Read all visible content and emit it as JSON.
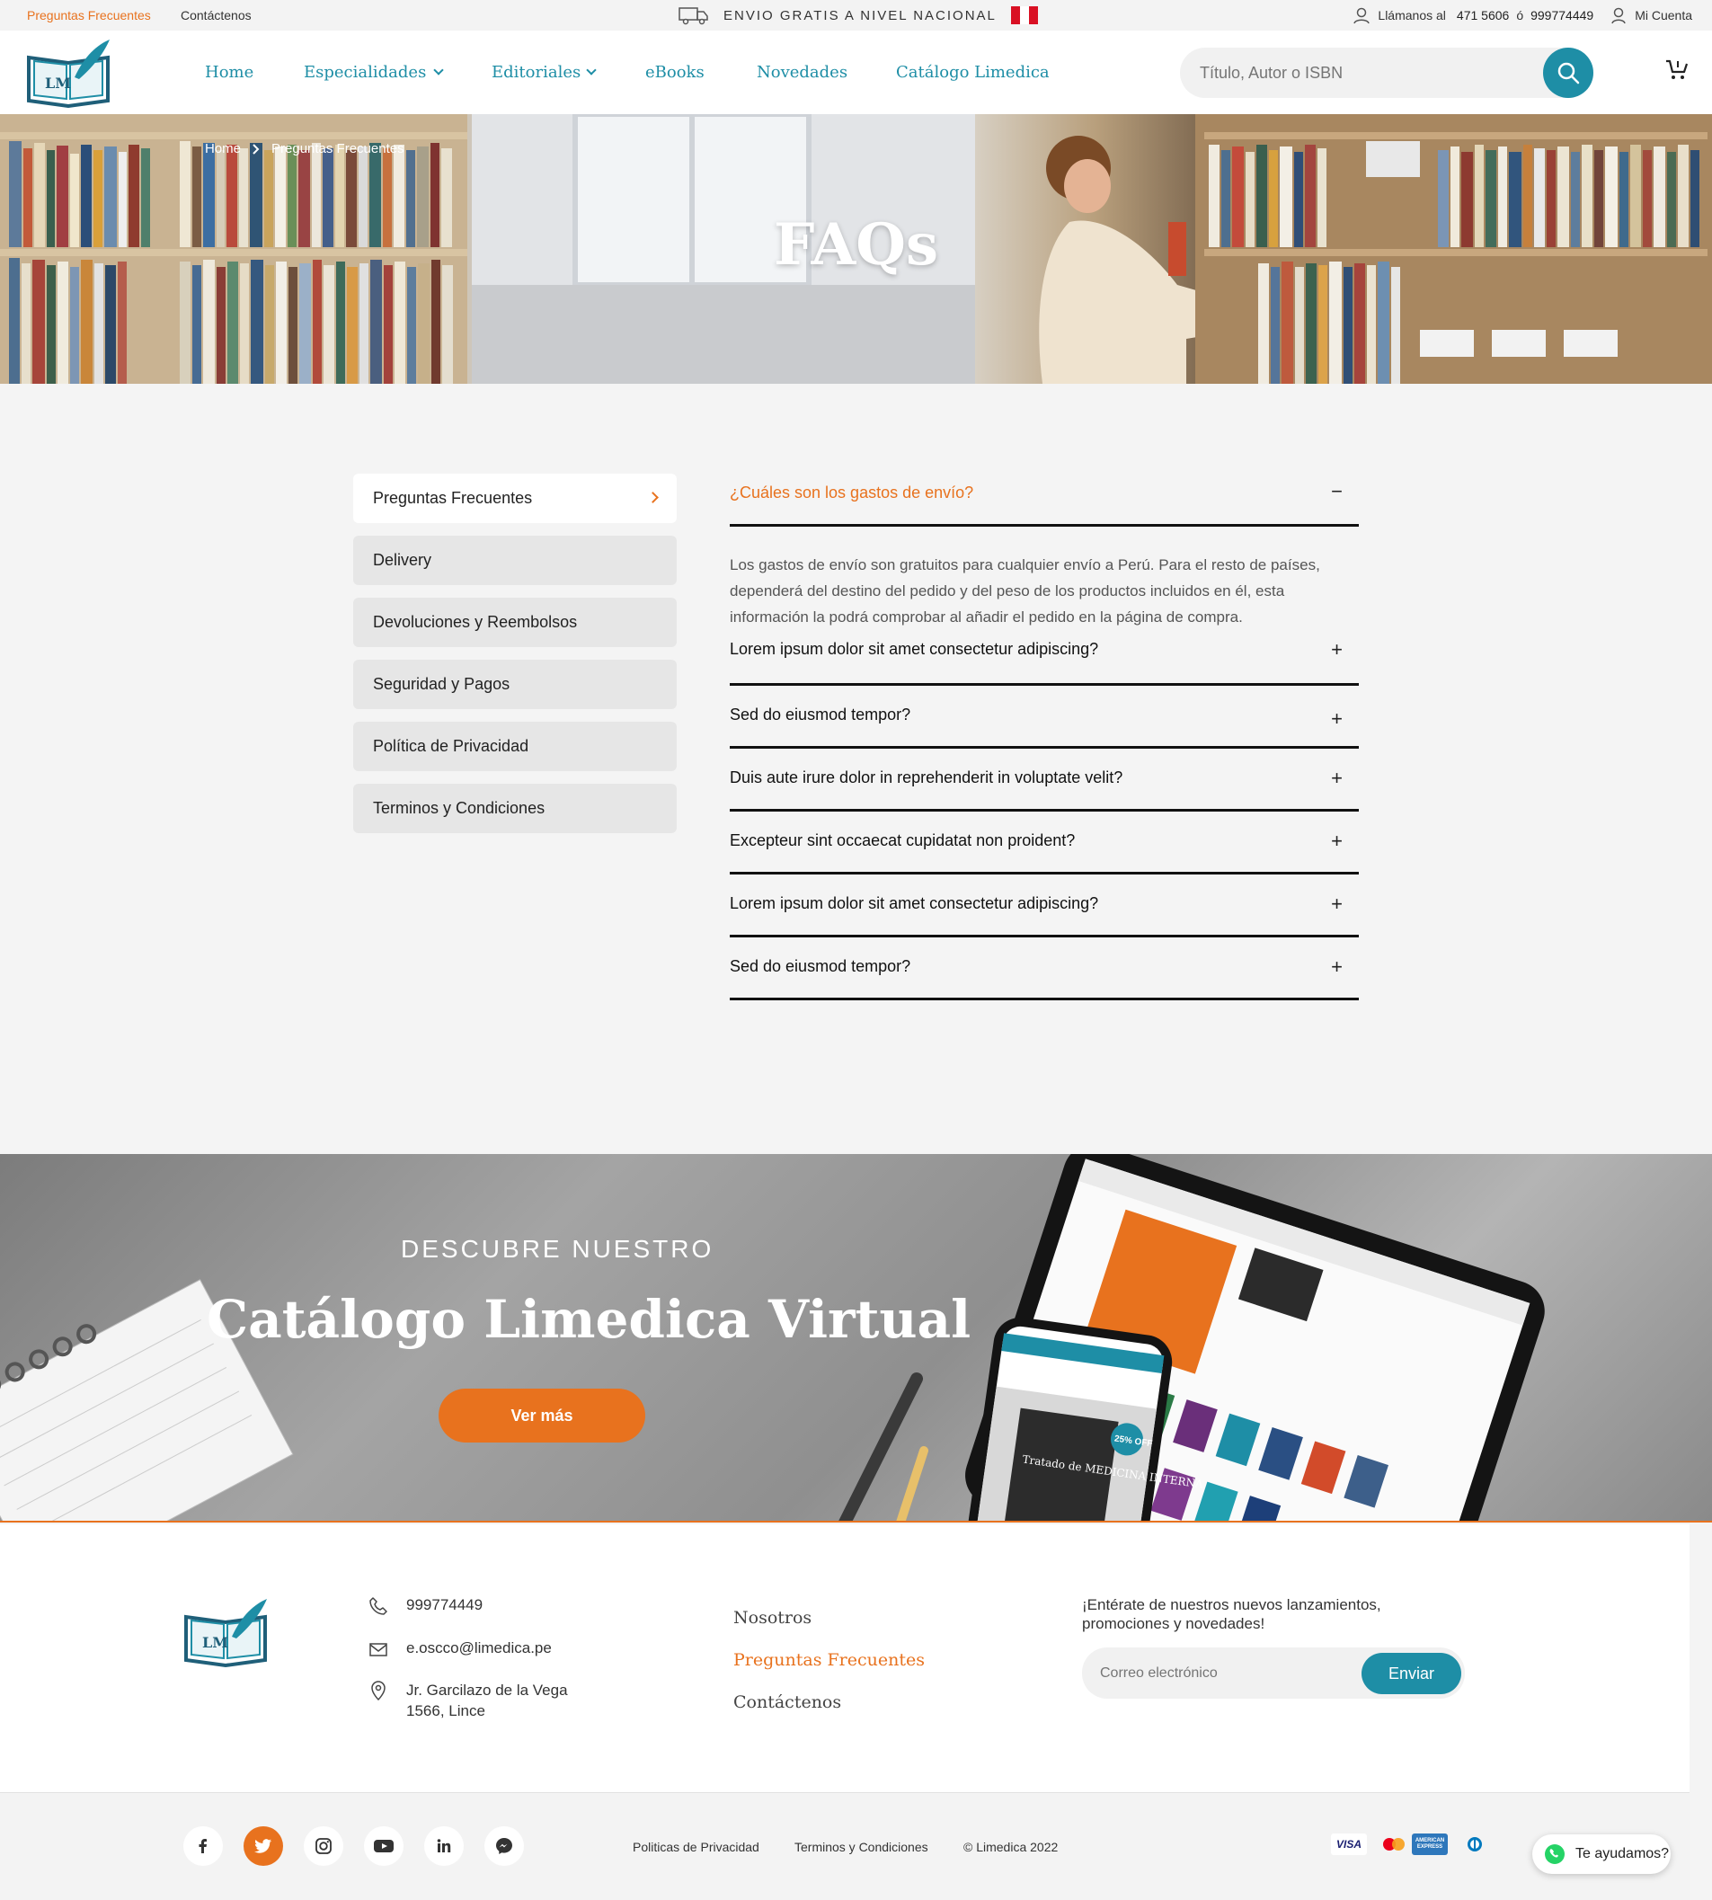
{
  "topbar": {
    "links": [
      "Preguntas Frecuentes",
      "Contáctenos"
    ],
    "shipping": "ENVIO GRATIS A NIVEL NACIONAL",
    "call_label": "Llámanos al",
    "phone1": "471 5606",
    "or": "ó",
    "phone2": "999774449",
    "account": "Mi Cuenta"
  },
  "nav": {
    "logo_text": "LM",
    "menu": [
      "Home",
      "Especialidades",
      "Editoriales",
      "eBooks",
      "Novedades",
      "Catálogo Limedica"
    ],
    "search_placeholder": "Título, Autor o ISBN"
  },
  "hero": {
    "breadcrumb": [
      "Home",
      "Preguntas Frecuentes"
    ],
    "title": "FAQs"
  },
  "sidebar": {
    "items": [
      "Preguntas Frecuentes",
      "Delivery",
      "Devoluciones y Reembolsos",
      "Seguridad y Pagos",
      "Política de Privacidad",
      "Terminos y Condiciones"
    ]
  },
  "faq": {
    "open_question": "¿Cuáles son los gastos de envío?",
    "open_answer": "Los gastos de envío son gratuitos para cualquier envío a Perú. Para el resto de países, dependerá del destino del pedido y del peso de los productos incluidos en él, esta información la podrá comprobar al añadir el pedido en la página de compra.",
    "questions": [
      "Lorem ipsum dolor sit amet consectetur adipiscing?",
      "Sed do eiusmod tempor?",
      "Duis aute irure dolor in reprehenderit in voluptate velit?",
      "Excepteur sint occaecat cupidatat non proident?",
      "Lorem ipsum dolor sit amet consectetur adipiscing?",
      "Sed do eiusmod tempor?"
    ]
  },
  "banner": {
    "subtitle": "DESCUBRE NUESTRO",
    "title": "Catálogo Limedica Virtual",
    "button": "Ver más",
    "phone_badge": "25% OFF",
    "book_title": "Tratado de MEDICINA INTERNA"
  },
  "footer": {
    "phone": "999774449",
    "email": "e.oscco@limedica.pe",
    "address_line1": "Jr. Garcilazo de la Vega",
    "address_line2": "1566, Lince",
    "links": [
      "Nosotros",
      "Preguntas Frecuentes",
      "Contáctenos"
    ],
    "newsletter_text": "¡Entérate de nuestros nuevos lanzamientos, promociones y novedades!",
    "email_placeholder": "Correo electrónico",
    "send": "Enviar"
  },
  "bottom": {
    "social": [
      "facebook-icon",
      "twitter-icon",
      "instagram-icon",
      "youtube-icon",
      "linkedin-icon",
      "messenger-icon"
    ],
    "links": [
      "Politicas de Privacidad",
      "Terminos y Condiciones",
      "© Limedica 2022"
    ],
    "payments": [
      "VISA",
      "mastercard",
      "AMERICAN EXPRESS",
      "diners"
    ],
    "whatsapp": "Te ayudamos?"
  },
  "colors": {
    "accent": "#e8721e",
    "brand": "#1e8ea6"
  }
}
